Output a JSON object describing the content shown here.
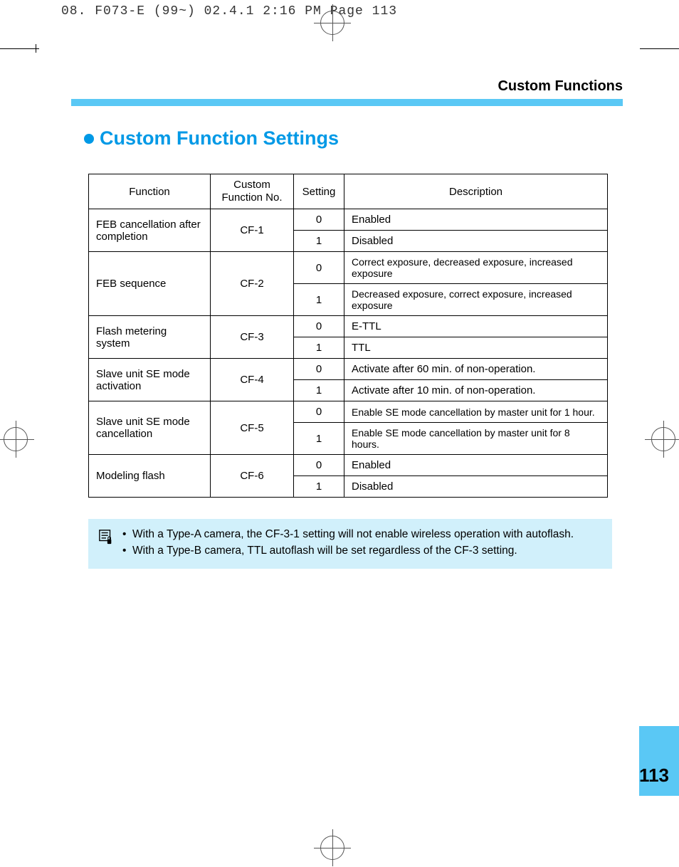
{
  "header_line": "08. F073-E (99~)  02.4.1 2:16 PM  Page 113",
  "section_header": "Custom Functions",
  "main_title": "Custom Function Settings",
  "table": {
    "headers": {
      "function": "Function",
      "cfno": "Custom Function No.",
      "setting": "Setting",
      "description": "Description"
    },
    "rows": [
      {
        "function": "FEB cancellation after completion",
        "cfno": "CF-1",
        "settings": [
          {
            "setting": "0",
            "desc": "Enabled"
          },
          {
            "setting": "1",
            "desc": "Disabled"
          }
        ]
      },
      {
        "function": "FEB sequence",
        "cfno": "CF-2",
        "settings": [
          {
            "setting": "0",
            "desc": "Correct exposure, decreased exposure, increased exposure"
          },
          {
            "setting": "1",
            "desc": "Decreased exposure, correct exposure, increased exposure"
          }
        ]
      },
      {
        "function": "Flash metering system",
        "cfno": "CF-3",
        "settings": [
          {
            "setting": "0",
            "desc": "E-TTL"
          },
          {
            "setting": "1",
            "desc": "TTL"
          }
        ]
      },
      {
        "function": "Slave unit SE mode activation",
        "cfno": "CF-4",
        "settings": [
          {
            "setting": "0",
            "desc": "Activate after 60 min. of non-operation."
          },
          {
            "setting": "1",
            "desc": "Activate after 10 min. of non-operation."
          }
        ]
      },
      {
        "function": "Slave unit SE mode cancellation",
        "cfno": "CF-5",
        "settings": [
          {
            "setting": "0",
            "desc": "Enable SE mode cancellation by master unit for 1 hour."
          },
          {
            "setting": "1",
            "desc": "Enable SE mode cancellation by master unit for 8 hours."
          }
        ]
      },
      {
        "function": "Modeling flash",
        "cfno": "CF-6",
        "settings": [
          {
            "setting": "0",
            "desc": "Enabled"
          },
          {
            "setting": "1",
            "desc": "Disabled"
          }
        ]
      }
    ]
  },
  "notes": [
    "With a Type-A camera, the CF-3-1 setting will not enable wireless operation with autoflash.",
    "With a Type-B camera, TTL autoflash will be set regardless of the CF-3 setting."
  ],
  "page_number": "113"
}
